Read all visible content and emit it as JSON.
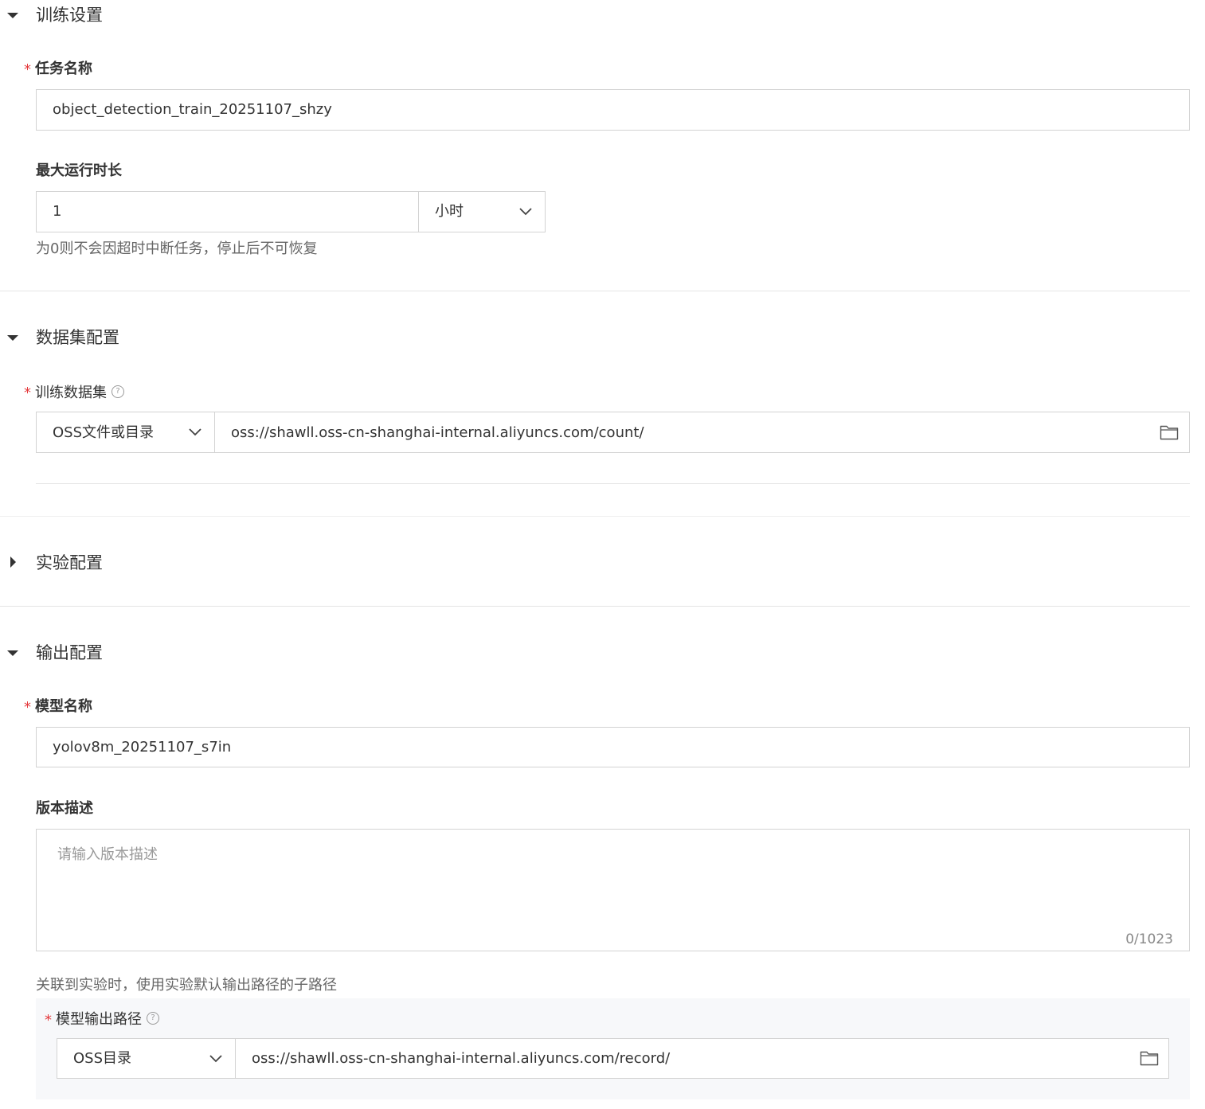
{
  "sections": {
    "training": {
      "title": "训练设置",
      "task_name": {
        "label": "任务名称",
        "value": "object_detection_train_20251107_shzy"
      },
      "max_runtime": {
        "label": "最大运行时长",
        "value": "1",
        "unit": "小时",
        "hint": "为0则不会因超时中断任务，停止后不可恢复"
      }
    },
    "dataset": {
      "title": "数据集配置",
      "train_dataset": {
        "label": "训练数据集",
        "help": "?",
        "source_type": "OSS文件或目录",
        "path": "oss://shawll.oss-cn-shanghai-internal.aliyuncs.com/count/"
      }
    },
    "experiment": {
      "title": "实验配置"
    },
    "output": {
      "title": "输出配置",
      "model_name": {
        "label": "模型名称",
        "value": "yolov8m_20251107_s7in"
      },
      "version_desc": {
        "label": "版本描述",
        "placeholder": "请输入版本描述",
        "counter": "0/1023"
      },
      "experiment_hint": "关联到实验时，使用实验默认输出路径的子路径",
      "output_path": {
        "label": "模型输出路径",
        "help": "?",
        "source_type": "OSS目录",
        "path": "oss://shawll.oss-cn-shanghai-internal.aliyuncs.com/record/"
      }
    }
  },
  "required_mark": "*"
}
